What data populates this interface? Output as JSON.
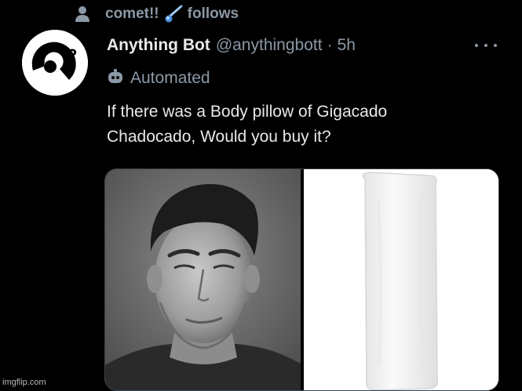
{
  "social_context": {
    "text_before": "comet!!",
    "text_after": "follows",
    "icon": "person-icon",
    "emoji_icon": "comet-icon"
  },
  "tweet": {
    "avatar_icon": "question-bot-logo",
    "display_name": "Anything Bot",
    "handle": "@anythingbott",
    "separator": "·",
    "time": "5h",
    "more_icon": "more-horizontal-icon",
    "automated_label": "Automated",
    "automated_icon": "bot-icon",
    "text_line1": "If there was a Body pillow of Gigacado",
    "text_line2": "Chadocado, Would you buy it?",
    "media": {
      "left_image": "grayscale-man-portrait",
      "right_image": "white-body-pillow"
    }
  },
  "watermark": "imgflip.com",
  "colors": {
    "background": "#000000",
    "text_primary": "#e7e9ea",
    "text_secondary": "#8b98a5",
    "border": "#38444d"
  }
}
